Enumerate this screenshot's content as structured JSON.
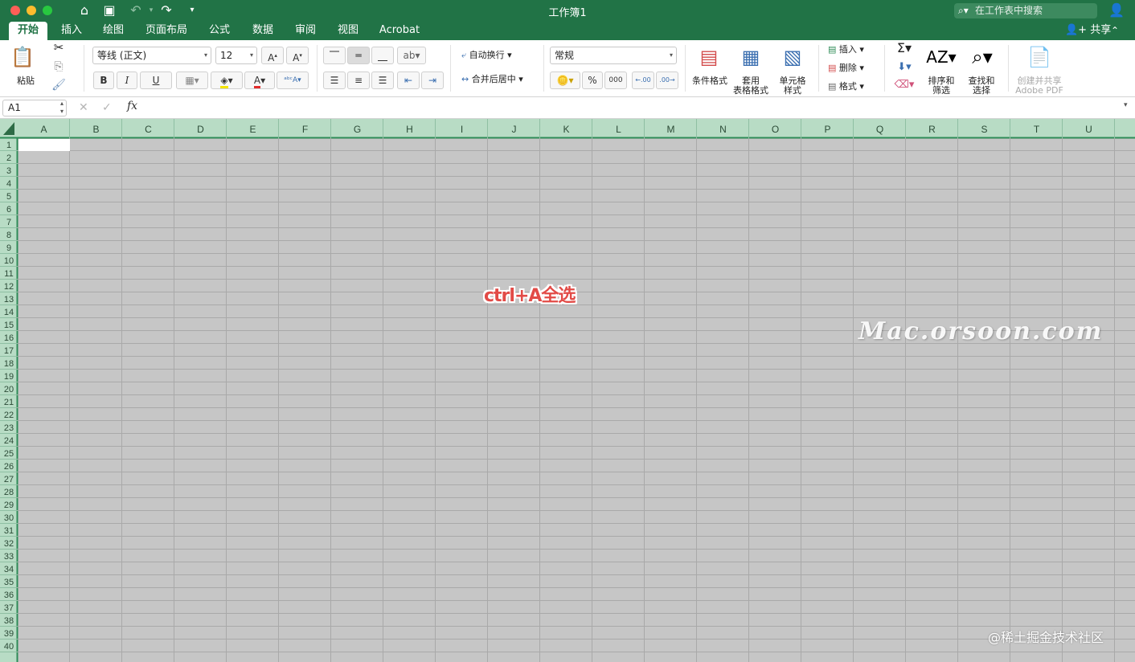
{
  "window": {
    "title": "工作簿1",
    "search_placeholder": "在工作表中搜索"
  },
  "tabs": [
    {
      "label": "开始",
      "active": true
    },
    {
      "label": "插入",
      "active": false
    },
    {
      "label": "绘图",
      "active": false
    },
    {
      "label": "页面布局",
      "active": false
    },
    {
      "label": "公式",
      "active": false
    },
    {
      "label": "数据",
      "active": false
    },
    {
      "label": "审阅",
      "active": false
    },
    {
      "label": "视图",
      "active": false
    },
    {
      "label": "Acrobat",
      "active": false
    }
  ],
  "share_label": "共享",
  "ribbon": {
    "paste": "粘贴",
    "font_name": "等线 (正文)",
    "font_size": "12",
    "bold": "B",
    "italic": "I",
    "underline": "U",
    "wrap_text": "自动换行",
    "merge_center": "合并后居中",
    "number_format": "常规",
    "percent": "%",
    "thousands": "000",
    "conditional_format": "条件格式",
    "format_as_table_1": "套用",
    "format_as_table_2": "表格格式",
    "cell_styles_1": "单元格",
    "cell_styles_2": "样式",
    "insert": "插入",
    "delete": "删除",
    "format": "格式",
    "sort_filter_1": "排序和",
    "sort_filter_2": "筛选",
    "find_select_1": "查找和",
    "find_select_2": "选择",
    "create_share_1": "创建并共享",
    "create_share_2": "Adobe PDF"
  },
  "formula_bar": {
    "name_box": "A1",
    "fx": "fx",
    "value": ""
  },
  "columns": [
    "A",
    "B",
    "C",
    "D",
    "E",
    "F",
    "G",
    "H",
    "I",
    "J",
    "K",
    "L",
    "M",
    "N",
    "O",
    "P",
    "Q",
    "R",
    "S",
    "T",
    "U"
  ],
  "rows": [
    "1",
    "2",
    "3",
    "4",
    "5",
    "6",
    "7",
    "8",
    "9",
    "10",
    "11",
    "12",
    "13",
    "14",
    "15",
    "16",
    "17",
    "18",
    "19",
    "20",
    "21",
    "22",
    "23",
    "24",
    "25",
    "26",
    "27",
    "28",
    "29",
    "30",
    "31",
    "32",
    "33",
    "34",
    "35",
    "36",
    "37",
    "38",
    "39",
    "40"
  ],
  "overlay": {
    "annotation": "ctrl+A全选",
    "watermark": "Mac.orsoon.com",
    "credit": "@稀土掘金技术社区"
  },
  "colors": {
    "accent": "#217346",
    "selection_header": "#b8dcc5",
    "selected_cells": "#c6c6c6",
    "annotation": "#e24b47"
  }
}
